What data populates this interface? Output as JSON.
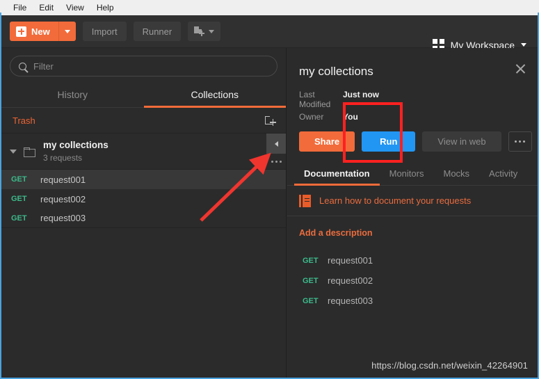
{
  "menubar": {
    "items": [
      {
        "label": "File"
      },
      {
        "label": "Edit"
      },
      {
        "label": "View"
      },
      {
        "label": "Help"
      }
    ]
  },
  "toolbar": {
    "new_label": "New",
    "new_icon": "plus-icon",
    "new_caret_icon": "caret-down-icon",
    "import_label": "Import",
    "runner_label": "Runner",
    "newtab_icon": "new-tab-icon",
    "newtab_caret_icon": "caret-down-icon",
    "workspace_label": "My Workspace",
    "workspace_icon": "grid-icon",
    "workspace_caret_icon": "caret-down-icon"
  },
  "sidebar": {
    "search": {
      "placeholder": "Filter",
      "value": "",
      "icon": "search-icon"
    },
    "tabs": [
      {
        "label": "History",
        "active": false
      },
      {
        "label": "Collections",
        "active": true
      }
    ],
    "trash_label": "Trash",
    "new_folder_icon": "new-folder-icon",
    "collection": {
      "name": "my collections",
      "meta": "3 requests",
      "expand_icon": "triangle-down-icon",
      "folder_icon": "folder-icon",
      "collapse_icon": "chevron-left-icon",
      "more_icon": "ellipsis-icon"
    },
    "requests": [
      {
        "method": "GET",
        "name": "request001",
        "selected": true
      },
      {
        "method": "GET",
        "name": "request002",
        "selected": false
      },
      {
        "method": "GET",
        "name": "request003",
        "selected": false
      }
    ]
  },
  "details": {
    "title": "my collections",
    "close_icon": "close-icon",
    "meta": [
      {
        "key": "Last Modified",
        "value": "Just now"
      },
      {
        "key": "Owner",
        "value": "You"
      }
    ],
    "actions": {
      "share": "Share",
      "run": "Run",
      "view_in_web": "View in web",
      "more_icon": "ellipsis-icon"
    },
    "tabs": [
      {
        "label": "Documentation",
        "active": true
      },
      {
        "label": "Monitors",
        "active": false
      },
      {
        "label": "Mocks",
        "active": false
      },
      {
        "label": "Activity",
        "active": false
      }
    ],
    "learn_label": "Learn how to document your requests",
    "learn_icon": "book-icon",
    "add_description_label": "Add a description",
    "doc_requests": [
      {
        "method": "GET",
        "name": "request001"
      },
      {
        "method": "GET",
        "name": "request002"
      },
      {
        "method": "GET",
        "name": "request003"
      }
    ]
  },
  "watermark": "https://blog.csdn.net/weixin_42264901",
  "colors": {
    "accent_orange": "#f26b3a",
    "run_blue": "#2196f3",
    "method_green": "#3cb98b",
    "annotation_red": "#ff2020",
    "panel_bg": "#2b2b2b",
    "toolbar_bg": "#303030",
    "menubar_bg": "#efefef",
    "focus_border": "#4aa3df"
  }
}
